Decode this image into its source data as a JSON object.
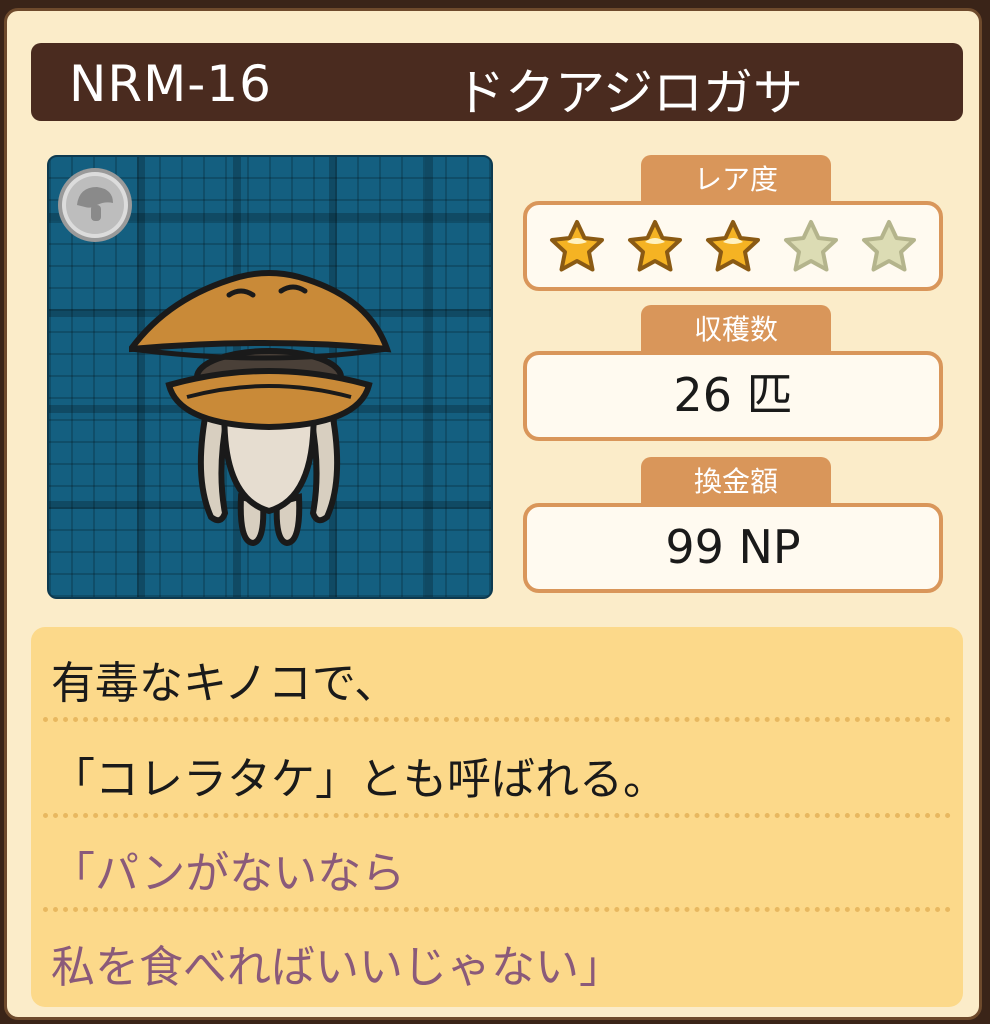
{
  "header": {
    "code": "NRM-16",
    "name": "ドクアジロガサ"
  },
  "portrait": {
    "badge_icon": "silver-mushroom-medal-icon",
    "image": "mushroom-character-illustration"
  },
  "rarity": {
    "label": "レア度",
    "filled": 3,
    "total": 5,
    "filled_color": "#f5b323",
    "empty_color": "#dcdcb4"
  },
  "harvest": {
    "label": "収穫数",
    "value": "26 匹"
  },
  "exchange": {
    "label": "換金額",
    "value": "99 NP"
  },
  "description": {
    "lines": [
      "有毒なキノコで、",
      "「コレラタケ」とも呼ばれる。",
      "「パンがないなら",
      "私を食べればいいじゃない」"
    ]
  },
  "colors": {
    "header_bg": "#4a2b1f",
    "card_bg": "#fbecc9",
    "tab_bg": "#d9965a",
    "desc_bg": "#fcd98a",
    "quote_text": "#8a5a7a"
  }
}
